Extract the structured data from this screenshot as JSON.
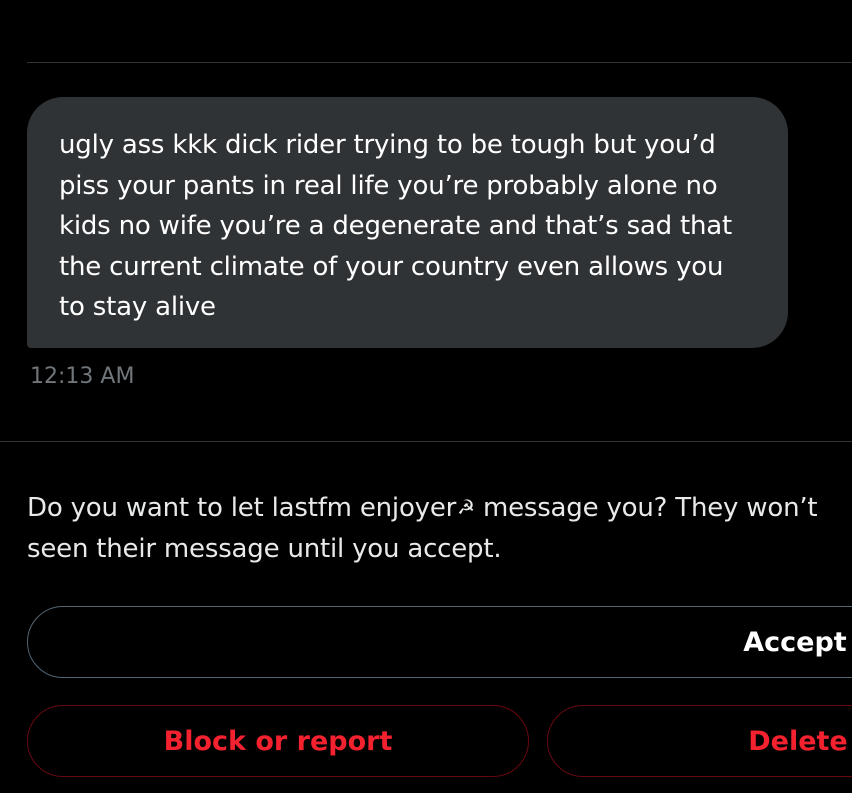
{
  "message": {
    "lines": [
      "ugly ass kkk dick rider trying to be tough but you’d",
      "piss your pants in real life you’re probably alone no",
      "kids no wife you’re a degenerate and that’s sad that",
      "the current climate of your country even allows you",
      "to stay alive"
    ],
    "timestamp": "12:13 AM"
  },
  "request": {
    "prompt_line1_before": "Do you want to let lastfm enjoyer",
    "prompt_emoji": "☭",
    "prompt_line1_after": " message you? They won’t",
    "prompt_line2": "seen their message until you accept."
  },
  "actions": {
    "accept_label": "Accept",
    "block_label": "Block or report",
    "delete_label": "Delete"
  },
  "colors": {
    "background": "#000000",
    "bubble": "#2f3336",
    "muted": "#71767b",
    "danger": "#f4212e",
    "divider": "#2f3336"
  }
}
